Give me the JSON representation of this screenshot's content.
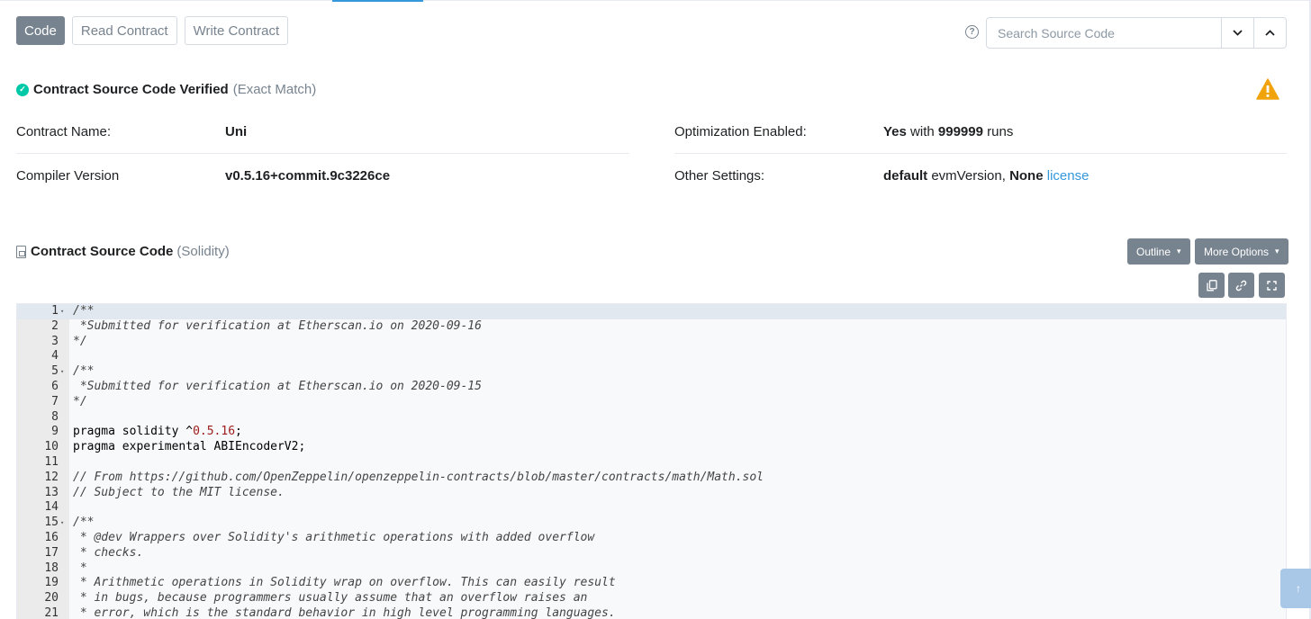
{
  "tabs": [
    {
      "label": "Code",
      "active": true
    },
    {
      "label": "Read Contract",
      "active": false
    },
    {
      "label": "Write Contract",
      "active": false
    }
  ],
  "search": {
    "placeholder": "Search Source Code"
  },
  "verified": {
    "title": "Contract Source Code Verified",
    "match": "(Exact Match)"
  },
  "info": {
    "contract_name_label": "Contract Name:",
    "contract_name": "Uni",
    "compiler_label": "Compiler Version",
    "compiler": "v0.5.16+commit.9c3226ce",
    "optimization_label": "Optimization Enabled:",
    "optimization_yes": "Yes",
    "optimization_with": "with",
    "optimization_runs": "999999",
    "optimization_runs_suffix": "runs",
    "other_label": "Other Settings:",
    "other_default": "default",
    "other_evm": "evmVersion,",
    "other_none": "None",
    "other_license": "license"
  },
  "source": {
    "title": "Contract Source Code",
    "lang": "(Solidity)",
    "outline_label": "Outline",
    "more_label": "More Options"
  },
  "code_lines": [
    {
      "n": "1",
      "fold": true,
      "text": "/**",
      "type": "comment"
    },
    {
      "n": "2",
      "fold": false,
      "text": " *Submitted for verification at Etherscan.io on 2020-09-16",
      "type": "comment"
    },
    {
      "n": "3",
      "fold": false,
      "text": "*/",
      "type": "comment"
    },
    {
      "n": "4",
      "fold": false,
      "text": "",
      "type": "plain"
    },
    {
      "n": "5",
      "fold": true,
      "text": "/**",
      "type": "comment"
    },
    {
      "n": "6",
      "fold": false,
      "text": " *Submitted for verification at Etherscan.io on 2020-09-15",
      "type": "comment"
    },
    {
      "n": "7",
      "fold": false,
      "text": "*/",
      "type": "comment"
    },
    {
      "n": "8",
      "fold": false,
      "text": "",
      "type": "plain"
    },
    {
      "n": "9",
      "fold": false,
      "text": "pragma solidity ^",
      "num": "0.5.16",
      "after": ";",
      "type": "pragma"
    },
    {
      "n": "10",
      "fold": false,
      "text": "pragma experimental ABIEncoderV2;",
      "type": "plain"
    },
    {
      "n": "11",
      "fold": false,
      "text": "",
      "type": "plain"
    },
    {
      "n": "12",
      "fold": false,
      "text": "// From https://github.com/OpenZeppelin/openzeppelin-contracts/blob/master/contracts/math/Math.sol",
      "type": "comment"
    },
    {
      "n": "13",
      "fold": false,
      "text": "// Subject to the MIT license.",
      "type": "comment"
    },
    {
      "n": "14",
      "fold": false,
      "text": "",
      "type": "plain"
    },
    {
      "n": "15",
      "fold": true,
      "text": "/**",
      "type": "comment"
    },
    {
      "n": "16",
      "fold": false,
      "text": " * @dev Wrappers over Solidity's arithmetic operations with added overflow",
      "type": "comment"
    },
    {
      "n": "17",
      "fold": false,
      "text": " * checks.",
      "type": "comment"
    },
    {
      "n": "18",
      "fold": false,
      "text": " *",
      "type": "comment"
    },
    {
      "n": "19",
      "fold": false,
      "text": " * Arithmetic operations in Solidity wrap on overflow. This can easily result",
      "type": "comment"
    },
    {
      "n": "20",
      "fold": false,
      "text": " * in bugs, because programmers usually assume that an overflow raises an",
      "type": "comment"
    },
    {
      "n": "21",
      "fold": false,
      "text": " * error, which is the standard behavior in high level programming languages.",
      "type": "comment"
    }
  ],
  "colors": {
    "accent": "#3498db",
    "secondary_button": "#77838f",
    "success": "#00c9a7",
    "warning": "#f0a30a"
  }
}
